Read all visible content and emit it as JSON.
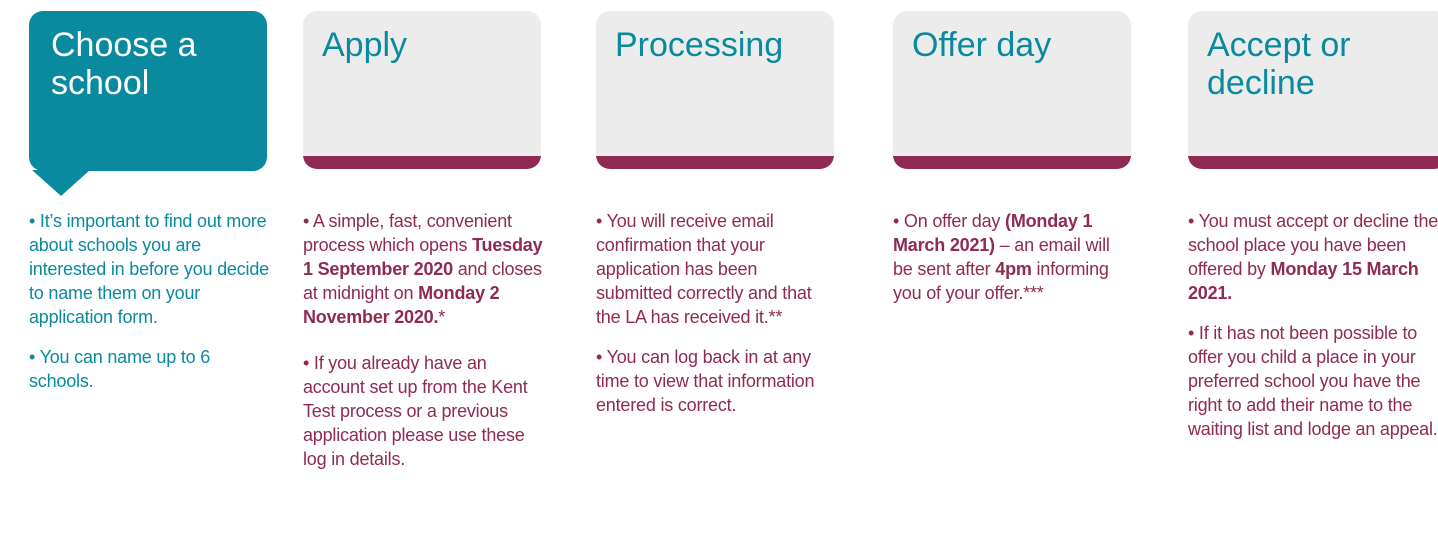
{
  "steps": [
    {
      "title": "Choose a school",
      "paragraphs": [
        [
          "• It’s important to find out more about schools you are interested in before you decide to name them on your application form."
        ],
        [
          "• You can name up to 6 schools."
        ]
      ]
    },
    {
      "title": "Apply",
      "p1_a": "• A simple, fast, convenient process which opens ",
      "p1_b": "Tuesday 1 September 2020",
      "p1_c": " and closes at midnight  on ",
      "p1_d": "Monday 2 November 2020.",
      "p1_e": "*",
      "p2": "• If you already have an account set up from the Kent Test process or a previous application please use these log in details."
    },
    {
      "title": "Processing",
      "p1": "• You will receive email confirmation that your application has been submitted correctly and that the LA has received it.**",
      "p2": "• You can log back in at any time to view that information entered is correct."
    },
    {
      "title": "Offer day",
      "p1_a": "• On offer day ",
      "p1_b": "(Monday 1 March 2021)",
      "p1_c": " – an email will be sent after ",
      "p1_d": "4pm",
      "p1_e": " informing you of your offer.***"
    },
    {
      "title": "Accept or decline",
      "p1_a": "• You must accept or decline the school place you have been offered by ",
      "p1_b": "Monday 15 March 2021.",
      "p2": "• If it has not been possible to offer you child a place in your preferred school you have the right to add their name to the waiting list and lodge an appeal."
    }
  ],
  "colors": {
    "teal": "#0a8a9f",
    "plum": "#8f2a55",
    "card_grey": "#ececec"
  }
}
